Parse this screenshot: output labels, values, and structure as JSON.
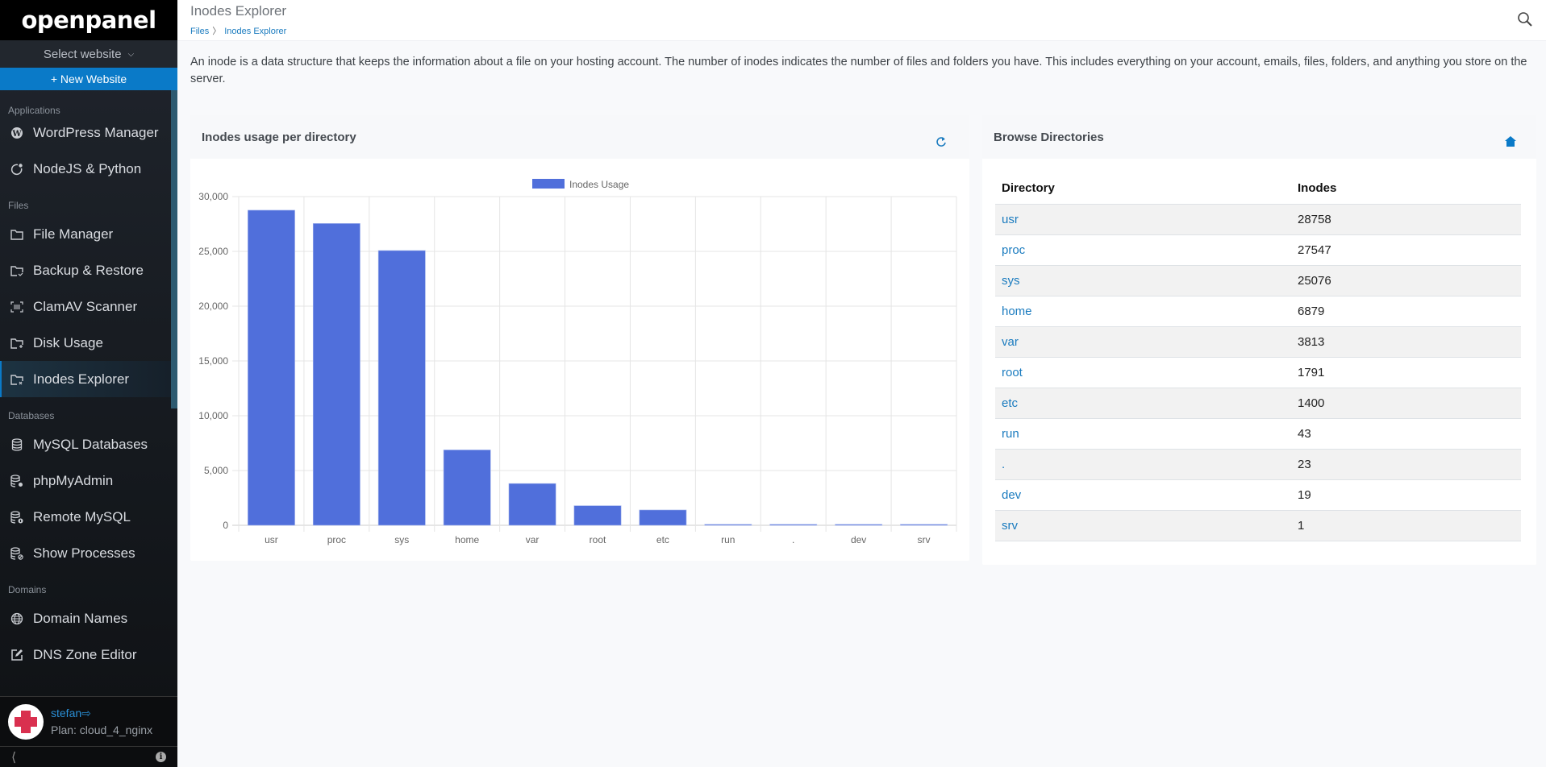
{
  "sidebar": {
    "logo": "openpanel",
    "select_website": "Select website",
    "new_website": "+ New Website",
    "sections": [
      {
        "title": "Applications",
        "items": [
          {
            "label": "WordPress Manager",
            "icon": "wordpress-icon"
          },
          {
            "label": "NodeJS & Python",
            "icon": "nodejs-icon"
          }
        ]
      },
      {
        "title": "Files",
        "items": [
          {
            "label": "File Manager",
            "icon": "folder-icon"
          },
          {
            "label": "Backup & Restore",
            "icon": "folder-check-icon"
          },
          {
            "label": "ClamAV Scanner",
            "icon": "barcode-scan-icon"
          },
          {
            "label": "Disk Usage",
            "icon": "folder-plus-icon"
          },
          {
            "label": "Inodes Explorer",
            "icon": "folder-x-icon",
            "active": true
          }
        ]
      },
      {
        "title": "Databases",
        "items": [
          {
            "label": "MySQL Databases",
            "icon": "database-icon"
          },
          {
            "label": "phpMyAdmin",
            "icon": "database-cog-icon"
          },
          {
            "label": "Remote MySQL",
            "icon": "database-info-icon"
          },
          {
            "label": "Show Processes",
            "icon": "database-block-icon"
          }
        ]
      },
      {
        "title": "Domains",
        "items": [
          {
            "label": "Domain Names",
            "icon": "globe-icon"
          },
          {
            "label": "DNS Zone Editor",
            "icon": "edit-icon"
          }
        ]
      }
    ],
    "user": {
      "name": "stefan",
      "plan": "Plan: cloud_4_nginx"
    }
  },
  "header": {
    "title": "Inodes Explorer",
    "breadcrumb": [
      "Files",
      "Inodes Explorer"
    ],
    "breadcrumb_sep": "〉"
  },
  "description": "An inode is a data structure that keeps the information about a file on your hosting account. The number of inodes indicates the number of files and folders you have. This includes everything on your account, emails, files, folders, and anything you store on the server.",
  "chart_card": {
    "title": "Inodes usage per directory"
  },
  "table_card": {
    "title": "Browse Directories",
    "columns": [
      "Directory",
      "Inodes"
    ],
    "rows": [
      {
        "dir": "usr",
        "inodes": "28758"
      },
      {
        "dir": "proc",
        "inodes": "27547"
      },
      {
        "dir": "sys",
        "inodes": "25076"
      },
      {
        "dir": "home",
        "inodes": "6879"
      },
      {
        "dir": "var",
        "inodes": "3813"
      },
      {
        "dir": "root",
        "inodes": "1791"
      },
      {
        "dir": "etc",
        "inodes": "1400"
      },
      {
        "dir": "run",
        "inodes": "43"
      },
      {
        "dir": ".",
        "inodes": "23"
      },
      {
        "dir": "dev",
        "inodes": "19"
      },
      {
        "dir": "srv",
        "inodes": "1"
      }
    ]
  },
  "colors": {
    "accent": "#0a7ac8",
    "bar": "#506fdb",
    "link": "#1a7bbf"
  },
  "chart_data": {
    "type": "bar",
    "title": "",
    "categories": [
      "usr",
      "proc",
      "sys",
      "home",
      "var",
      "root",
      "etc",
      "run",
      ".",
      "dev",
      "srv"
    ],
    "series": [
      {
        "name": "Inodes Usage",
        "values": [
          28758,
          27547,
          25076,
          6879,
          3813,
          1791,
          1400,
          43,
          23,
          19,
          1
        ]
      }
    ],
    "ylim": [
      0,
      30000
    ],
    "yticks": [
      0,
      5000,
      10000,
      15000,
      20000,
      25000,
      30000
    ],
    "ytick_labels": [
      "0",
      "5,000",
      "10,000",
      "15,000",
      "20,000",
      "25,000",
      "30,000"
    ],
    "xlabel": "",
    "ylabel": "",
    "grid": true,
    "legend": "top-center"
  }
}
